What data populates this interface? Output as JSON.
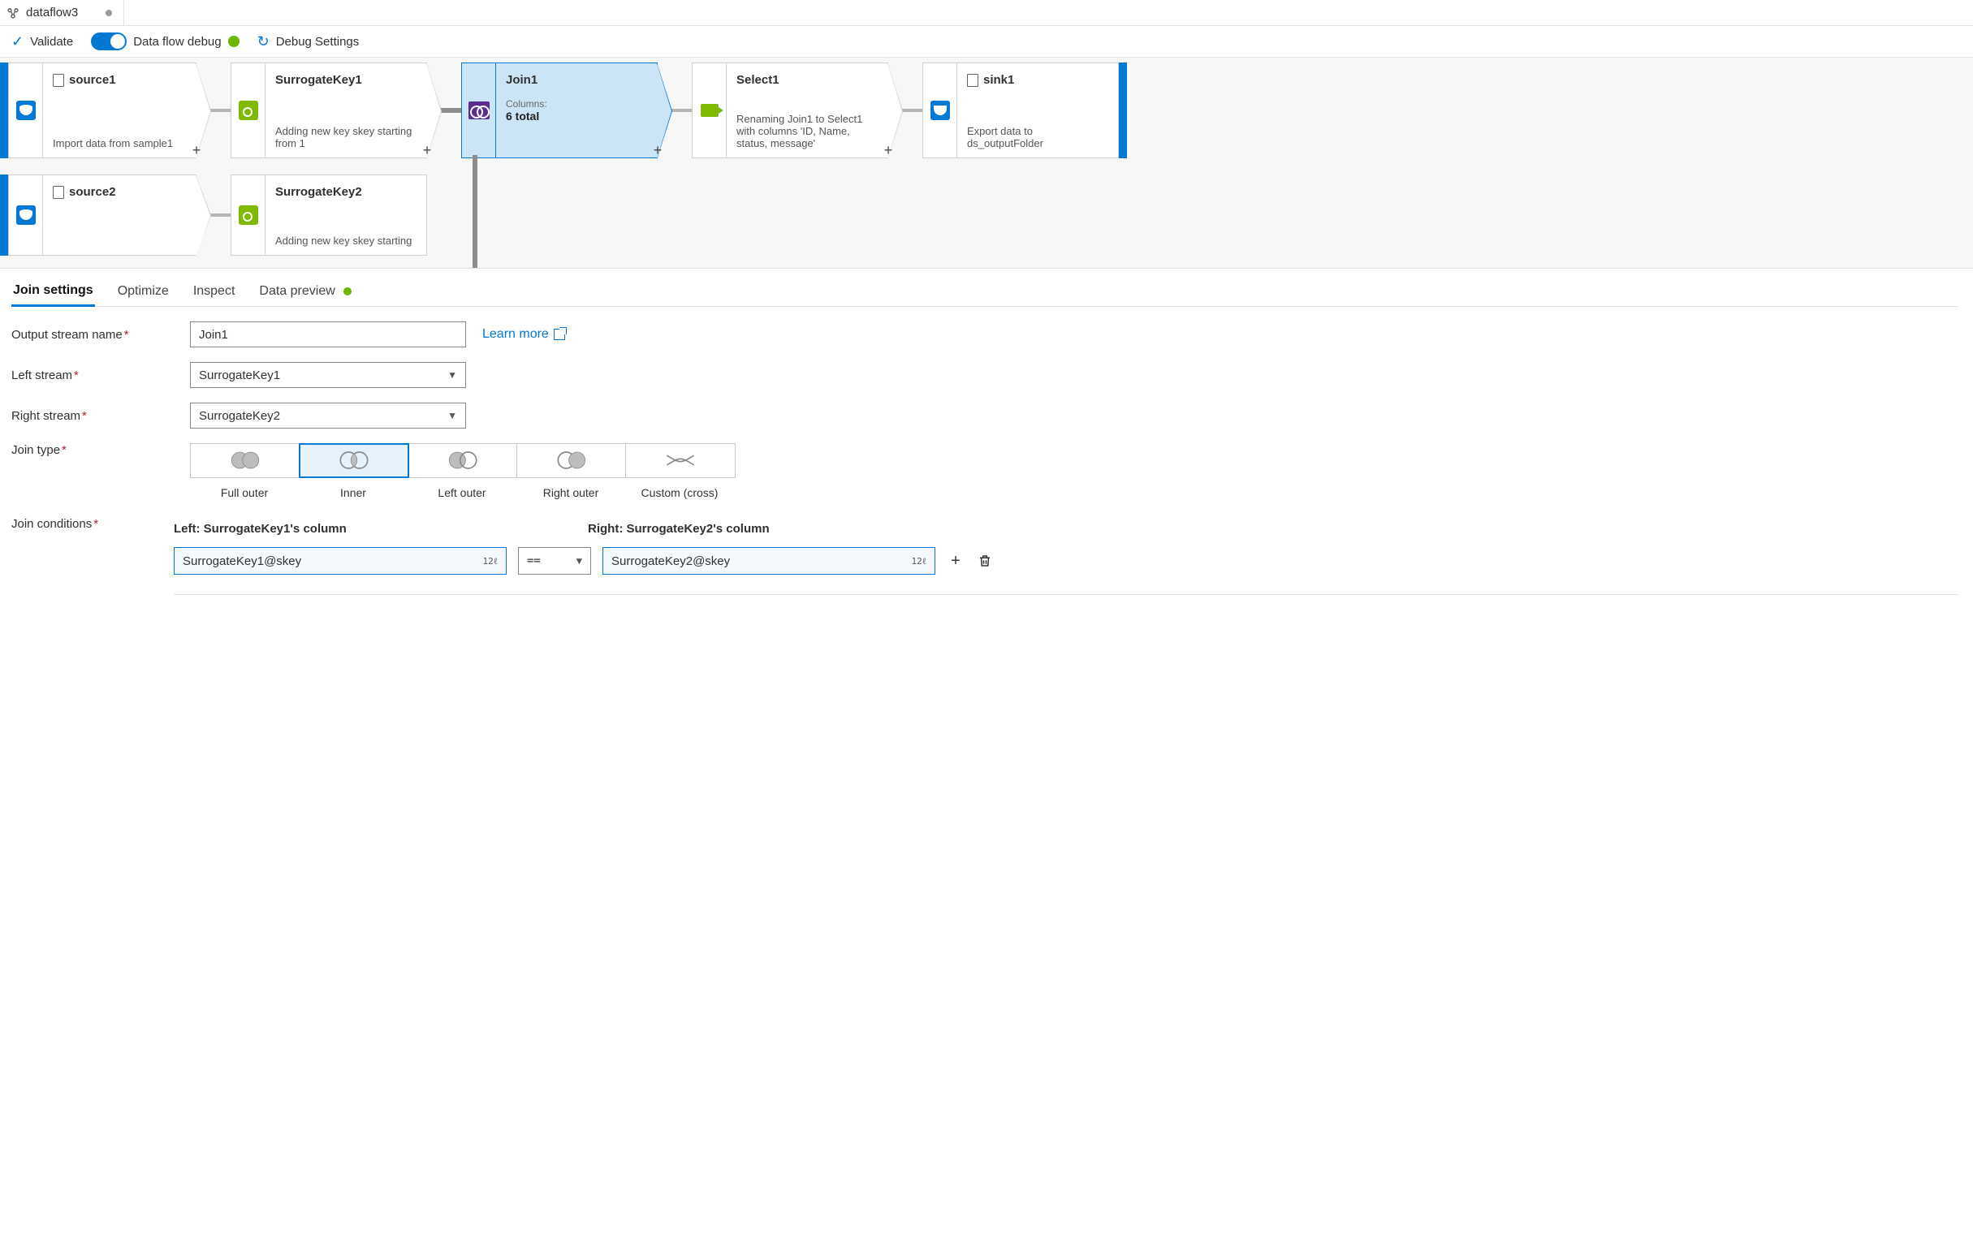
{
  "tab": {
    "title": "dataflow3"
  },
  "toolbar": {
    "validate": "Validate",
    "debug_label": "Data flow debug",
    "debug_settings": "Debug Settings"
  },
  "nodes": {
    "source1": {
      "title": "source1",
      "desc": "Import data from sample1"
    },
    "sk1": {
      "title": "SurrogateKey1",
      "desc": "Adding new key skey starting from 1"
    },
    "join1": {
      "title": "Join1",
      "columns_label": "Columns:",
      "columns_value": "6 total"
    },
    "select1": {
      "title": "Select1",
      "desc": "Renaming Join1 to Select1 with columns 'ID, Name, status, message'"
    },
    "sink1": {
      "title": "sink1",
      "desc": "Export data to ds_outputFolder"
    },
    "source2": {
      "title": "source2"
    },
    "sk2": {
      "title": "SurrogateKey2",
      "desc": "Adding new key skey starting"
    }
  },
  "settings_tabs": {
    "join": "Join settings",
    "optimize": "Optimize",
    "inspect": "Inspect",
    "preview": "Data preview"
  },
  "form": {
    "output_label": "Output stream name",
    "output_value": "Join1",
    "learn_more": "Learn more",
    "left_label": "Left stream",
    "left_value": "SurrogateKey1",
    "right_label": "Right stream",
    "right_value": "SurrogateKey2",
    "join_type_label": "Join type",
    "join_cond_label": "Join conditions",
    "join_types": {
      "full": "Full outer",
      "inner": "Inner",
      "left": "Left outer",
      "right": "Right outer",
      "cross": "Custom (cross)"
    },
    "cond": {
      "left_header": "Left: SurrogateKey1's column",
      "right_header": "Right: SurrogateKey2's column",
      "left_value": "SurrogateKey1@skey",
      "right_value": "SurrogateKey2@skey",
      "op": "==",
      "badge": "12ℓ"
    }
  }
}
